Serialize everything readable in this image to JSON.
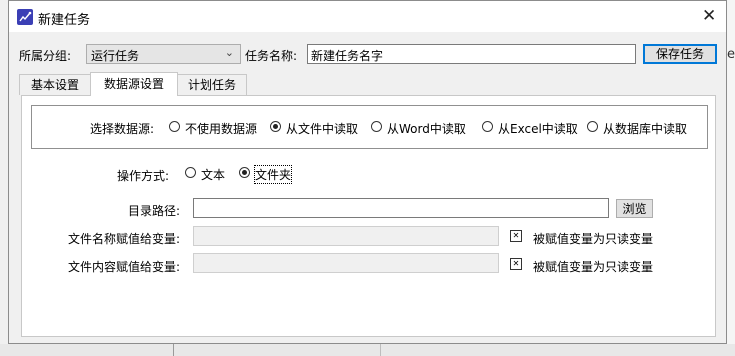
{
  "window": {
    "title": "新建任务"
  },
  "toolbar": {
    "group_label": "所属分组:",
    "group_value": "运行任务",
    "name_label": "任务名称:",
    "name_value": "新建任务名字",
    "save_label": "保存任务"
  },
  "tabs": [
    {
      "label": "基本设置",
      "active": false
    },
    {
      "label": "数据源设置",
      "active": true
    },
    {
      "label": "计划任务",
      "active": false
    }
  ],
  "datasource": {
    "label": "选择数据源:",
    "options": [
      {
        "label": "不使用数据源",
        "selected": false
      },
      {
        "label": "从文件中读取",
        "selected": true
      },
      {
        "label": "从Word中读取",
        "selected": false
      },
      {
        "label": "从Excel中读取",
        "selected": false
      },
      {
        "label": "从数据库中读取",
        "selected": false
      }
    ]
  },
  "operation": {
    "label": "操作方式:",
    "options": [
      {
        "label": "文本",
        "selected": false
      },
      {
        "label": "文件夹",
        "selected": true
      }
    ]
  },
  "fields": {
    "dir_label": "目录路径:",
    "dir_value": "",
    "browse_label": "浏览",
    "filename_var_label": "文件名称赋值给变量:",
    "filename_var_value": "",
    "filename_readonly_label": "被赋值变量为只读变量",
    "content_var_label": "文件内容赋值给变量:",
    "content_var_value": "",
    "content_readonly_label": "被赋值变量为只读变量"
  }
}
